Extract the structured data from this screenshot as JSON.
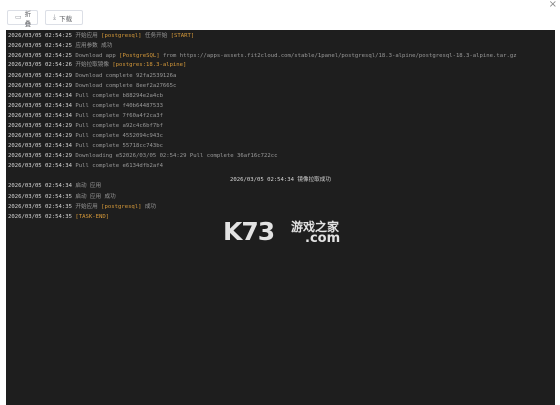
{
  "toolbar": {
    "fold_label": "折叠",
    "download_label": "下载",
    "close_glyph": "×"
  },
  "log": [
    {
      "ts": "2026/03/05 02:54:25",
      "parts": [
        {
          "t": "开始应用 ",
          "c": "msg"
        },
        {
          "t": "[postgresql]",
          "c": "hl"
        },
        {
          "t": " 任务开始 ",
          "c": "msg"
        },
        {
          "t": "[START]",
          "c": "hl"
        }
      ]
    },
    {
      "ts": "2026/03/05 02:54:25",
      "parts": [
        {
          "t": "应用参数 成功",
          "c": "msg"
        }
      ]
    },
    {
      "ts": "2026/03/05 02:54:25",
      "parts": [
        {
          "t": "Download app ",
          "c": "msg"
        },
        {
          "t": "[PostgreSQL]",
          "c": "hl"
        },
        {
          "t": " from https://apps-assets.fit2cloud.com/stable/1panel/postgresql/18.3-alpine/postgresql-18.3-alpine.tar.gz",
          "c": "link"
        }
      ]
    },
    {
      "ts": "2026/03/05 02:54:26",
      "parts": [
        {
          "t": "开始拉取镜像 ",
          "c": "msg"
        },
        {
          "t": "[postgres:18.3-alpine]",
          "c": "hl"
        }
      ]
    },
    {
      "ts": "2026/03/05 02:54:29",
      "parts": [
        {
          "t": "Download complete 92fa2539126a",
          "c": "msg"
        }
      ]
    },
    {
      "ts": "2026/03/05 02:54:29",
      "parts": [
        {
          "t": "Download complete 8eef2a27665c",
          "c": "msg"
        }
      ]
    },
    {
      "ts": "2026/03/05 02:54:34",
      "parts": [
        {
          "t": "Pull complete b88294e2a4cb",
          "c": "msg"
        }
      ]
    },
    {
      "ts": "2026/03/05 02:54:34",
      "parts": [
        {
          "t": "Pull complete f40b64487533",
          "c": "msg"
        }
      ]
    },
    {
      "ts": "2026/03/05 02:54:34",
      "parts": [
        {
          "t": "Pull complete 7f60a4f2ca3f",
          "c": "msg"
        }
      ]
    },
    {
      "ts": "2026/03/05 02:54:29",
      "parts": [
        {
          "t": "Pull complete a92c4c6bf7bf",
          "c": "msg"
        }
      ]
    },
    {
      "ts": "2026/03/05 02:54:29",
      "parts": [
        {
          "t": "Pull complete 4552094c943c",
          "c": "msg"
        }
      ]
    },
    {
      "ts": "2026/03/05 02:54:34",
      "parts": [
        {
          "t": "Pull complete 55718cc743bc",
          "c": "msg"
        }
      ]
    },
    {
      "ts": "2026/03/05 02:54:29",
      "parts": [
        {
          "t": "Downloading e52026/03/05 02:54:29 Pull complete 36af16c722cc",
          "c": "msg"
        }
      ]
    },
    {
      "ts": "2026/03/05 02:54:34",
      "parts": [
        {
          "t": "Pull complete e6134dfb2af4",
          "c": "msg"
        }
      ]
    },
    {
      "ts": "2026/03/05 02:54:34",
      "parts": [
        {
          "t": "启动 应用",
          "c": "msg"
        }
      ]
    },
    {
      "ts": "2026/03/05 02:54:35",
      "parts": [
        {
          "t": "启动 应用 成功",
          "c": "msg"
        }
      ]
    },
    {
      "ts": "2026/03/05 02:54:35",
      "parts": [
        {
          "t": "开始应用 ",
          "c": "msg"
        },
        {
          "t": "[postgresql]",
          "c": "hl"
        },
        {
          "t": " 成功",
          "c": "msg"
        }
      ]
    },
    {
      "ts": "2026/03/05 02:54:35",
      "parts": [
        {
          "t": "[TASK-END]",
          "c": "hl"
        }
      ]
    }
  ],
  "center_line": "2026/03/05 02:54:34 镜像拉取成功",
  "watermark": {
    "main": "K73",
    "cn": "游戏之家",
    "com": ".com"
  }
}
